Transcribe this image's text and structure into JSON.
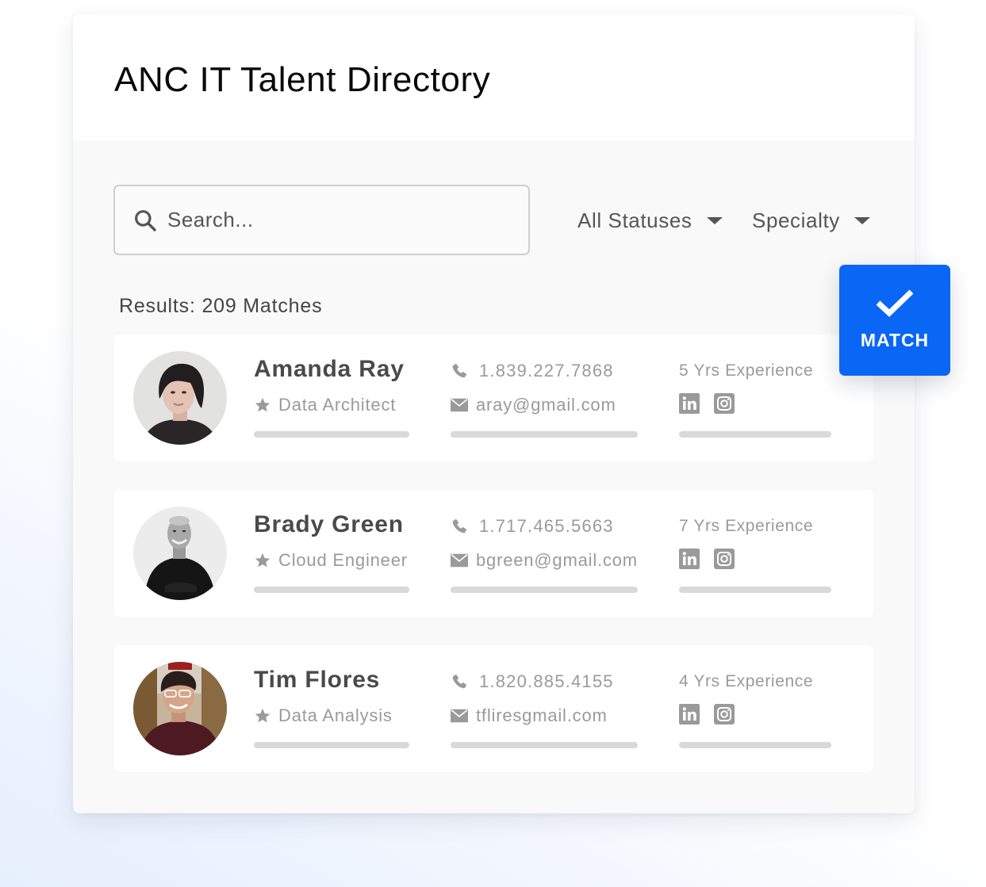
{
  "header": {
    "title": "ANC IT Talent Directory"
  },
  "filters": {
    "search_placeholder": "Search...",
    "search_value": "",
    "status_dropdown": {
      "selected": "All Statuses"
    },
    "specialty_dropdown": {
      "selected": "Specialty"
    }
  },
  "results": {
    "summary": "Results: 209 Matches",
    "count": 209
  },
  "match_button": {
    "label": "MATCH",
    "icon": "checkmark-icon",
    "color": "#0a66f5"
  },
  "candidates": [
    {
      "name": "Amanda Ray",
      "role": "Data Architect",
      "phone": "1.839.227.7868",
      "email": "aray@gmail.com",
      "experience": "5 Yrs Experience",
      "socials": [
        "linkedin-icon",
        "instagram-icon"
      ]
    },
    {
      "name": "Brady Green",
      "role": "Cloud Engineer",
      "phone": "1.717.465.5663",
      "email": "bgreen@gmail.com",
      "experience": "7 Yrs Experience",
      "socials": [
        "linkedin-icon",
        "instagram-icon"
      ]
    },
    {
      "name": "Tim Flores",
      "role": "Data Analysis",
      "phone": "1.820.885.4155",
      "email": "tfliresgmail.com",
      "experience": "4 Yrs Experience",
      "socials": [
        "linkedin-icon",
        "instagram-icon"
      ]
    }
  ],
  "colors": {
    "accent": "#0a66f5",
    "muted_text": "#9a9a9a",
    "name_text": "#4a4a4a",
    "placeholder_bar": "#d9d9d9"
  }
}
